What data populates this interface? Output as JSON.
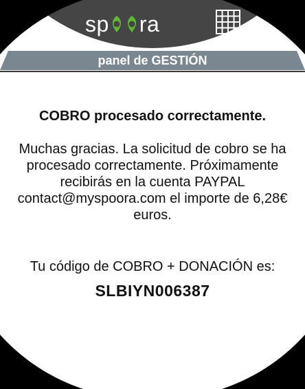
{
  "header": {
    "logo_text_left": "sp",
    "logo_text_right": "ra",
    "logo_accent_color": "#5fb833",
    "grid_icon": "grid-icon"
  },
  "panel": {
    "title": "panel de GESTIÓN"
  },
  "main": {
    "heading": "COBRO procesado correctamente.",
    "message": "Muchas gracias. La solicitud de cobro se ha procesado correctamente. Próximamente recibirás en la cuenta PAYPAL contact@myspoora.com el importe de 6,28€ euros.",
    "code_label": "Tu código de COBRO + DONACIÓN es:",
    "code_value": "SLBIYN006387"
  }
}
